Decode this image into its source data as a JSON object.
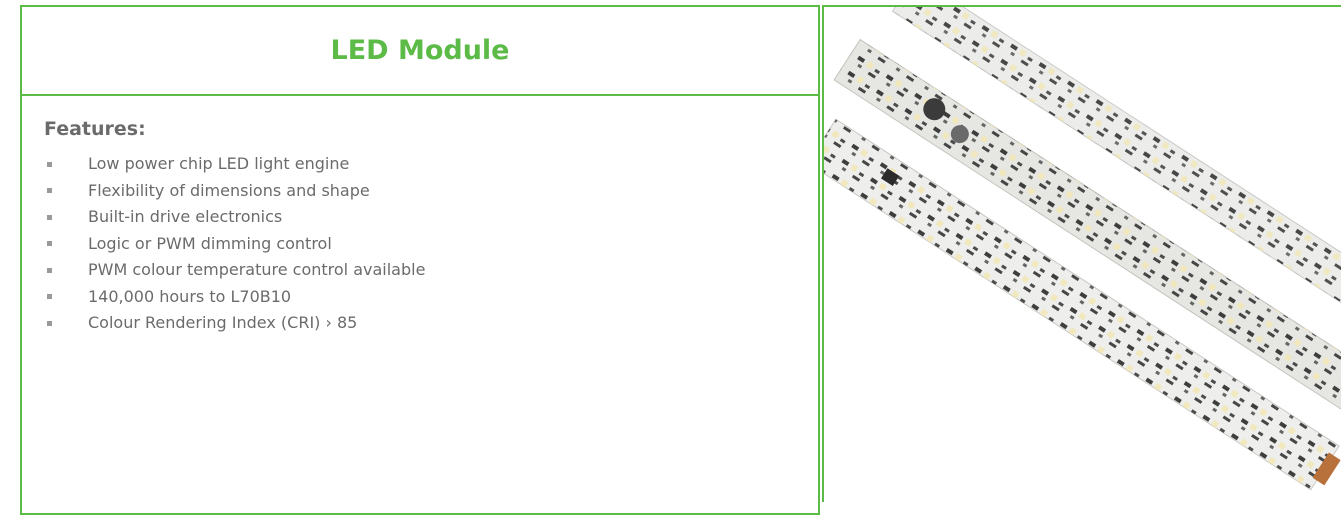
{
  "module": {
    "title": "LED Module",
    "features_heading": "Features:",
    "features": [
      "Low power chip LED light engine",
      "Flexibility of dimensions and shape",
      "Built-in drive electronics",
      "Logic or PWM dimming control",
      "PWM colour temperature control available",
      "140,000 hours to L70B10",
      "Colour Rendering Index (CRI) › 85"
    ]
  },
  "colors": {
    "accent_green": "#5cba47",
    "text_gray": "#6b6b6b",
    "bullet_gray": "#9a9a9a"
  },
  "photo": {
    "subject": "led-module-circuit-boards"
  }
}
